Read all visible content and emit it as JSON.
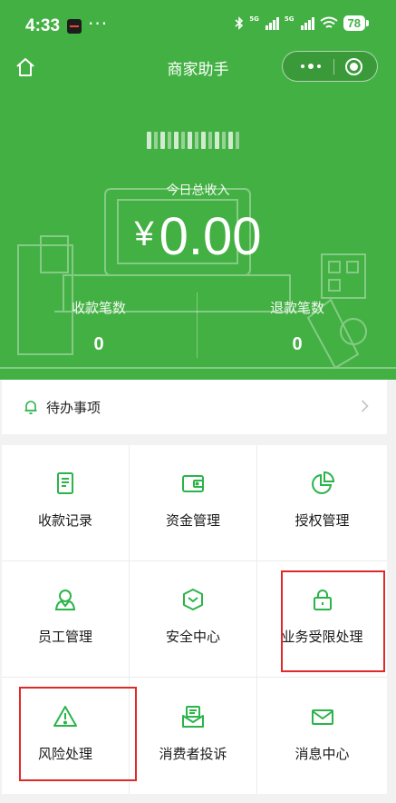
{
  "status_bar": {
    "time": "4:33",
    "more": "···",
    "battery": "78",
    "network_label": "5G"
  },
  "navbar": {
    "title": "商家助手"
  },
  "summary": {
    "merchant_name_masked": "",
    "income_label": "今日总收入",
    "currency": "¥",
    "income_value": "0.00",
    "collect_count_label": "收款笔数",
    "collect_count_value": "0",
    "refund_count_label": "退款笔数",
    "refund_count_value": "0"
  },
  "todo": {
    "label": "待办事项"
  },
  "menu": [
    {
      "label": "收款记录",
      "icon": "receipt-icon"
    },
    {
      "label": "资金管理",
      "icon": "wallet-icon"
    },
    {
      "label": "授权管理",
      "icon": "pie-chart-icon"
    },
    {
      "label": "员工管理",
      "icon": "person-icon"
    },
    {
      "label": "安全中心",
      "icon": "shield-icon"
    },
    {
      "label": "业务受限处理",
      "icon": "lock-icon"
    },
    {
      "label": "风险处理",
      "icon": "warning-icon"
    },
    {
      "label": "消费者投诉",
      "icon": "complaint-icon"
    },
    {
      "label": "消息中心",
      "icon": "mail-icon"
    }
  ],
  "colors": {
    "brand_green": "#43b043",
    "icon_green": "#2bb44a",
    "highlight_red": "#e02a2a"
  }
}
